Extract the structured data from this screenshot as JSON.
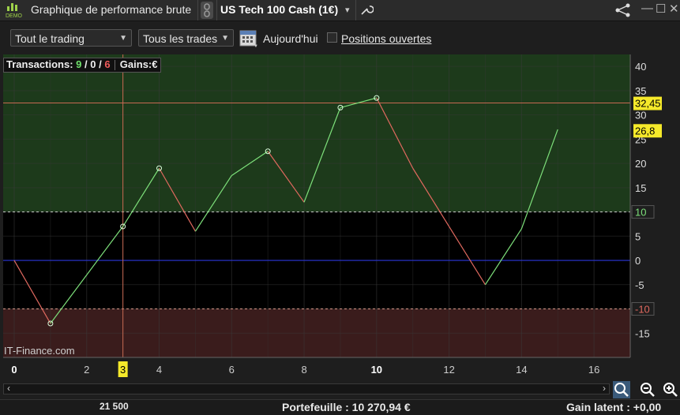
{
  "titlebar": {
    "demo_label": "DEMO",
    "title": "Graphique de performance brute",
    "instrument": "US Tech 100 Cash (1€)"
  },
  "toolbar": {
    "filter_trading": "Tout le trading",
    "filter_trades": "Tous les trades",
    "today_label": "Aujourd'hui",
    "open_positions_label": "Positions ouvertes"
  },
  "info": {
    "label": "Transactions:",
    "wins": "9",
    "sep1": " / ",
    "neutral": "0",
    "sep2": " / ",
    "losses": "6",
    "gains_label": "Gains:",
    "gains_currency": "€"
  },
  "watermark": "IT-Finance.com",
  "footer": {
    "left_value": "21 500",
    "portfolio": "Portefeuille : 10 270,94 €",
    "latent": "Gain latent :  +0,00"
  },
  "colors": {
    "up": "#7de07a",
    "down": "#e0695f",
    "profit_zone": "#1d3a1b",
    "loss_zone": "#3a1c1c",
    "zero_line": "#2b37d9",
    "marker_label_bg": "#f5e92a",
    "threshold_line": "#c86a52"
  },
  "chart_data": {
    "type": "line",
    "x": [
      0,
      1,
      2,
      3,
      4,
      5,
      6,
      7,
      8,
      9,
      10,
      11,
      12,
      13,
      14,
      15
    ],
    "y": [
      0,
      -13,
      -3,
      7,
      19,
      6,
      17.5,
      22.5,
      12,
      31.5,
      33.5,
      19,
      7,
      -5,
      6.5,
      27
    ],
    "markers_at": [
      1,
      3,
      4,
      7,
      9,
      10
    ],
    "xlim": [
      0,
      17
    ],
    "ylim": [
      -20,
      41
    ],
    "x_ticks": [
      0,
      2,
      4,
      6,
      8,
      10,
      12,
      14,
      16
    ],
    "y_ticks": [
      40,
      35,
      30,
      25,
      20,
      15,
      10,
      5,
      0,
      -5,
      -10,
      -15
    ],
    "profit_threshold": 10,
    "loss_threshold": -10,
    "max_label": "32,45",
    "max_value": 32.45,
    "current_label": "26,8",
    "current_value": 26.8,
    "cursor_x_label": "3",
    "cursor_x": 3,
    "bold_x_ticks": [
      0,
      10
    ]
  }
}
